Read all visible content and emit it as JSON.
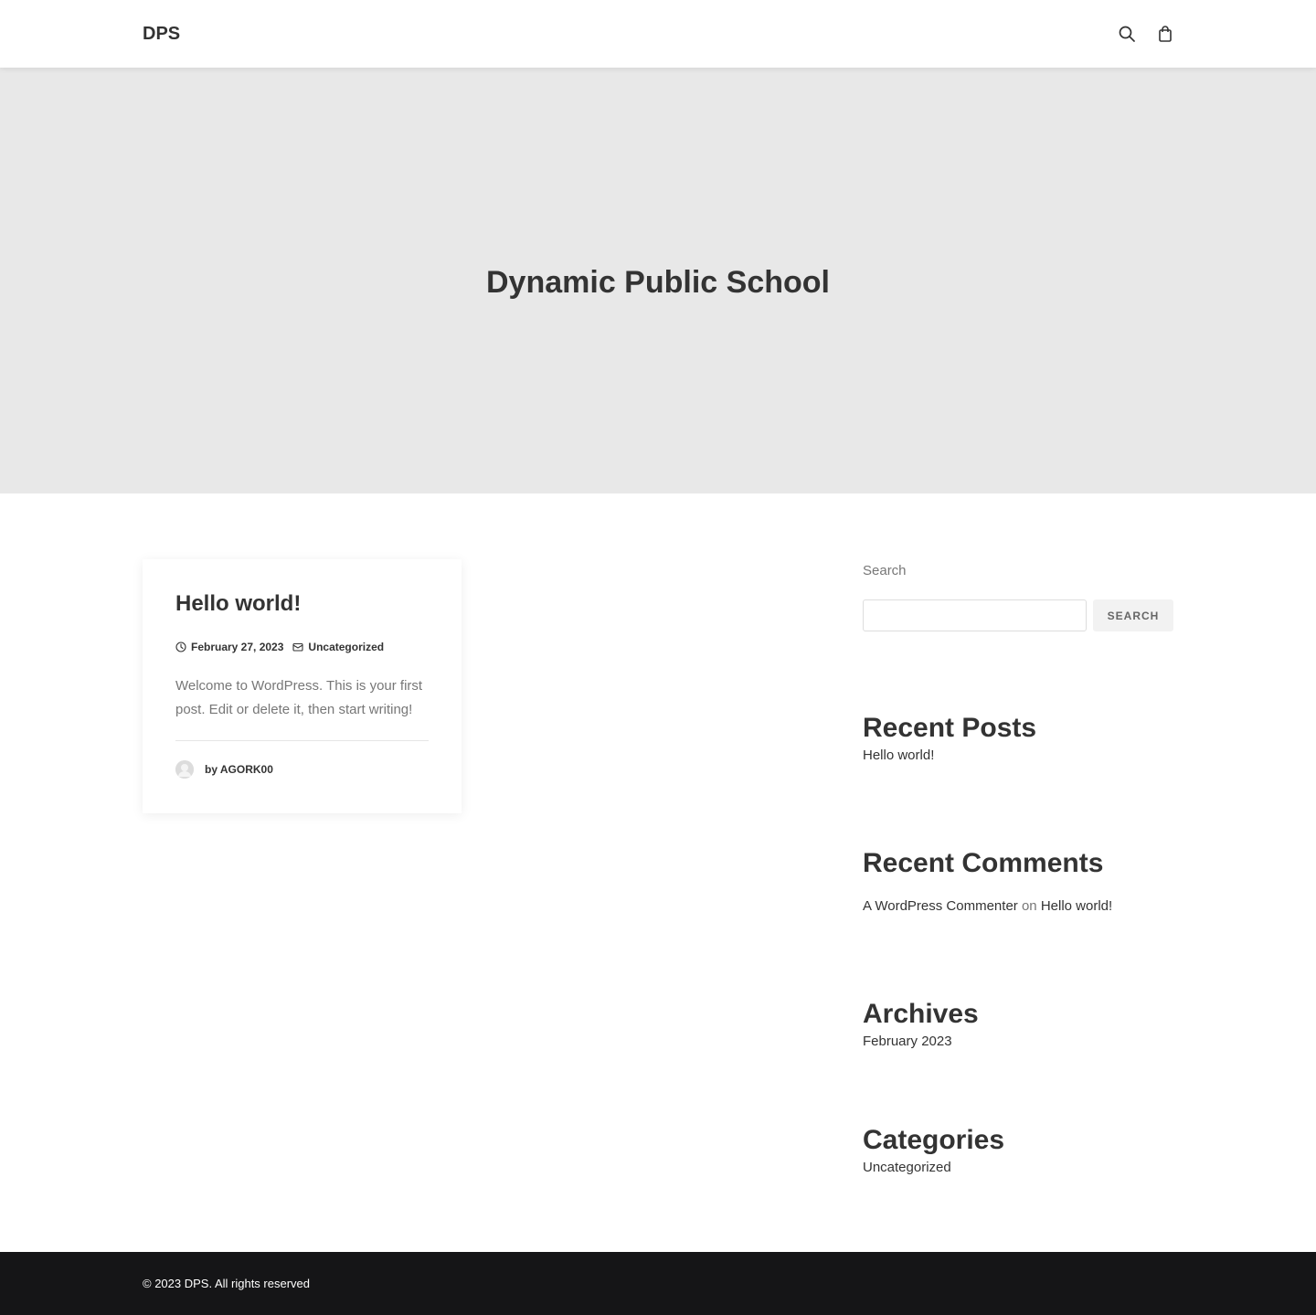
{
  "header": {
    "logo": "DPS",
    "icons": [
      "search-icon",
      "shopping-bag-icon"
    ]
  },
  "hero": {
    "title": "Dynamic Public School"
  },
  "post": {
    "title": "Hello world!",
    "date": "February 27, 2023",
    "category": "Uncategorized",
    "excerpt": "Welcome to WordPress. This is your first post. Edit or delete it, then start writing!",
    "author": "by AGORK00"
  },
  "sidebar": {
    "search_label": "Search",
    "search_input_value": "",
    "search_button": "Search",
    "recent_posts": {
      "title": "Recent Posts",
      "items": [
        "Hello world!"
      ]
    },
    "recent_comments": {
      "title": "Recent Comments",
      "author": "A WordPress Commenter",
      "on": "on",
      "post": "Hello world!"
    },
    "archives": {
      "title": "Archives",
      "items": [
        "February 2023"
      ]
    },
    "categories": {
      "title": "Categories",
      "items": [
        "Uncategorized"
      ]
    }
  },
  "footer": {
    "copyright": "© 2023 DPS. All rights reserved"
  },
  "colors": {
    "hero_background": "#e8e8e8",
    "footer_background": "#151517",
    "text": "#333333",
    "muted_text": "#777777"
  }
}
